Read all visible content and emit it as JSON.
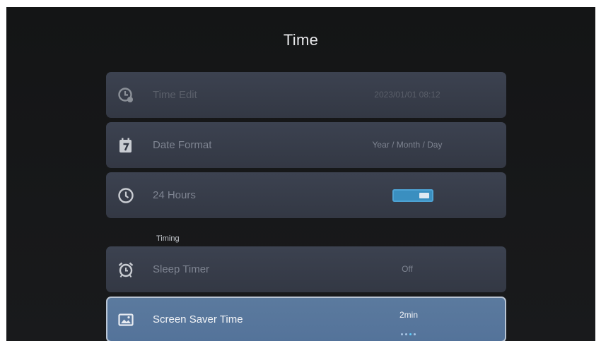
{
  "page": {
    "title": "Time"
  },
  "rows": [
    {
      "label": "Time Edit",
      "value": "2023/01/01 08:12",
      "icon": "clock-edit-icon"
    },
    {
      "label": "Date Format",
      "value": "Year / Month / Day",
      "icon": "calendar-icon"
    },
    {
      "label": "24 Hours",
      "toggle_on": true,
      "icon": "clock-icon"
    }
  ],
  "section": {
    "label": "Timing"
  },
  "timing_rows": [
    {
      "label": "Sleep Timer",
      "value": "Off",
      "icon": "alarm-clock-icon"
    },
    {
      "label": "Screen Saver Time",
      "value": "2min",
      "icon": "image-icon",
      "selected": true
    }
  ],
  "colors": {
    "background": "#141516",
    "row": "#3a3f4b",
    "selected_row": "#587699",
    "toggle": "#3a8fc0"
  }
}
